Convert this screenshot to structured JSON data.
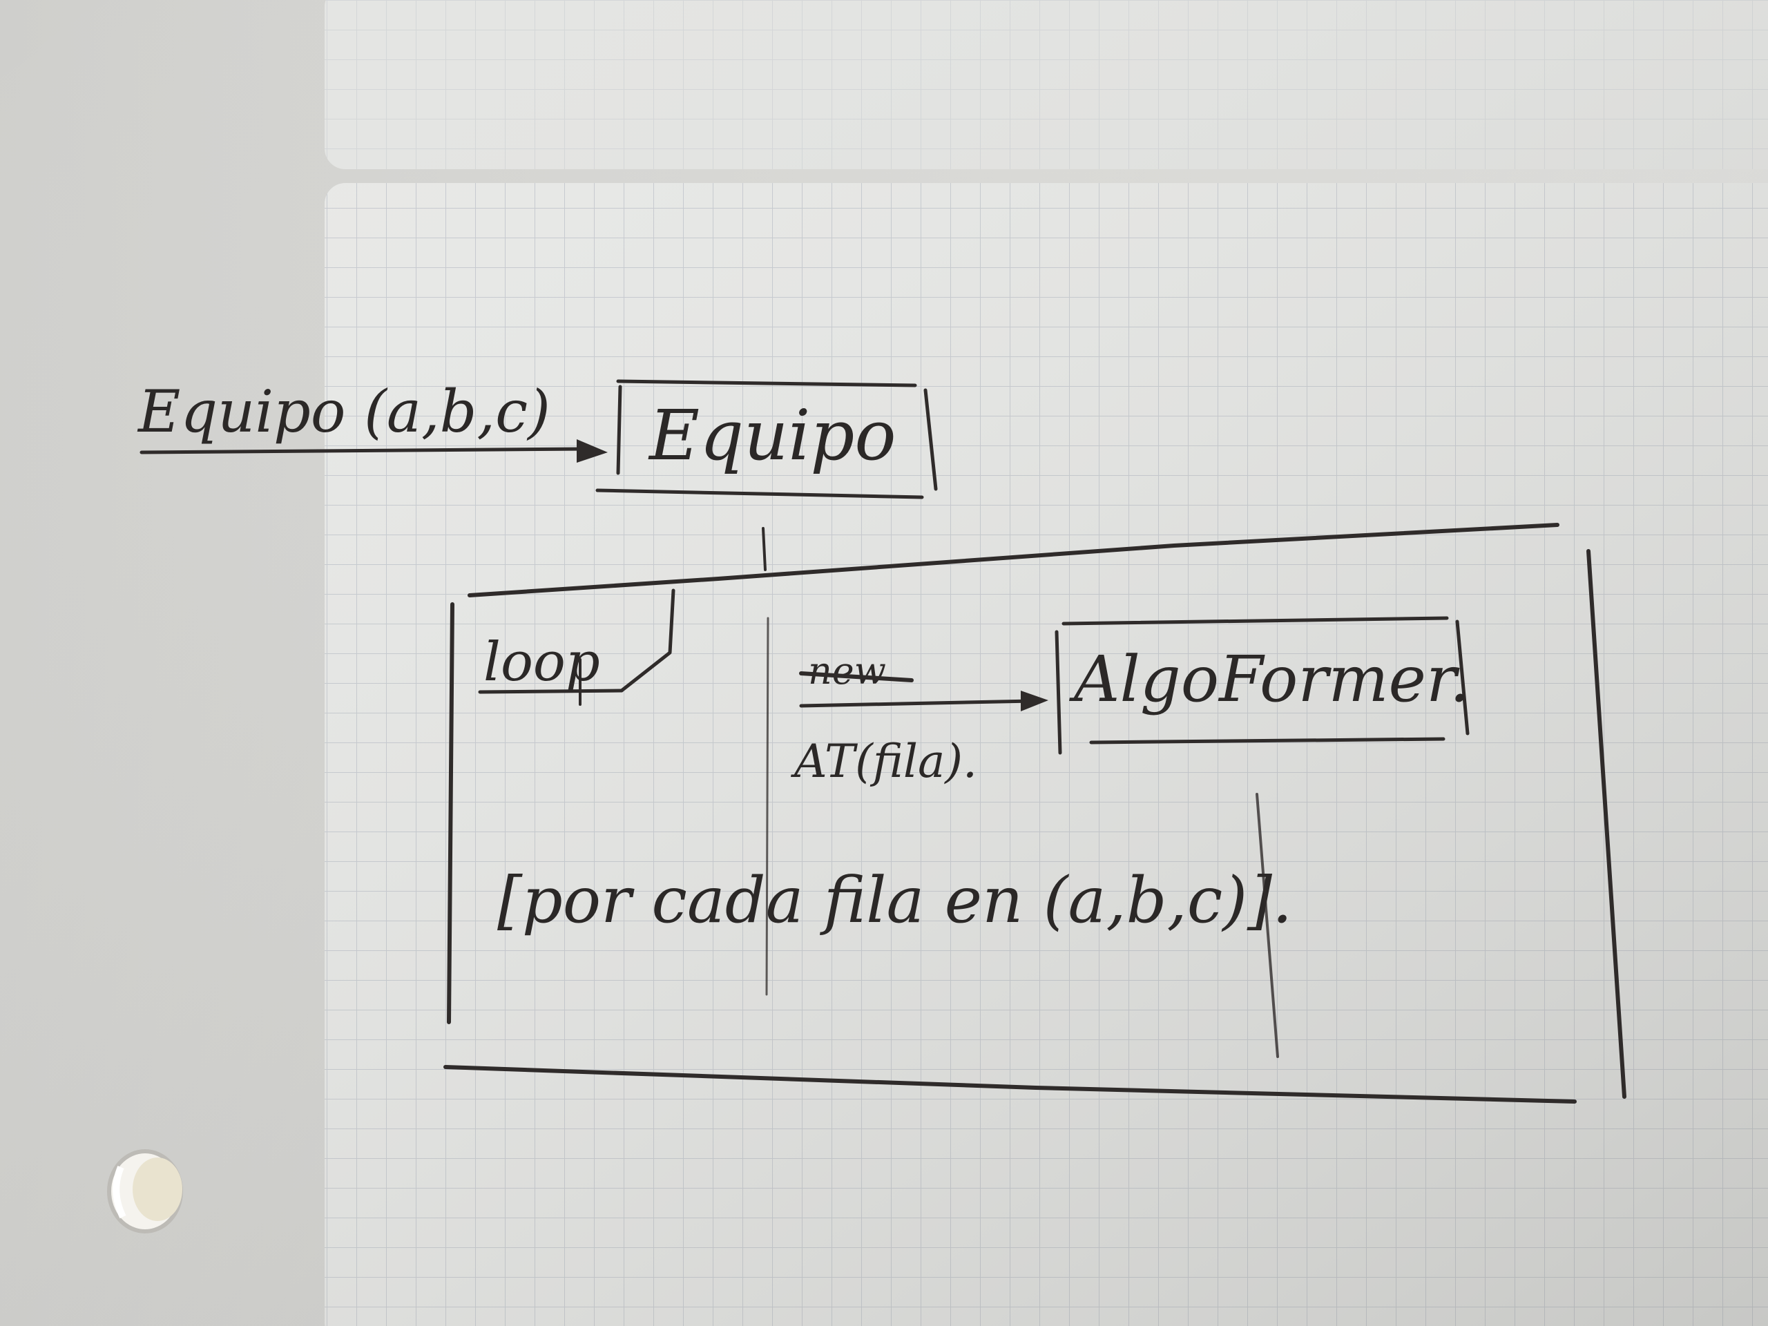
{
  "diagram": {
    "initial_message": "Equipo (a,b,c)",
    "lifeline_equipo": "Equipo",
    "fragment_operator": "loop",
    "struck_message": "new",
    "create_message": "AT(fila).",
    "lifeline_algoformer": "AlgoFormer.",
    "guard": "[por cada fila en (a,b,c)].",
    "colors": {
      "ink": "#2f2b2a",
      "paper": "#e6e6e3",
      "grid": "#c9cdd2"
    }
  }
}
